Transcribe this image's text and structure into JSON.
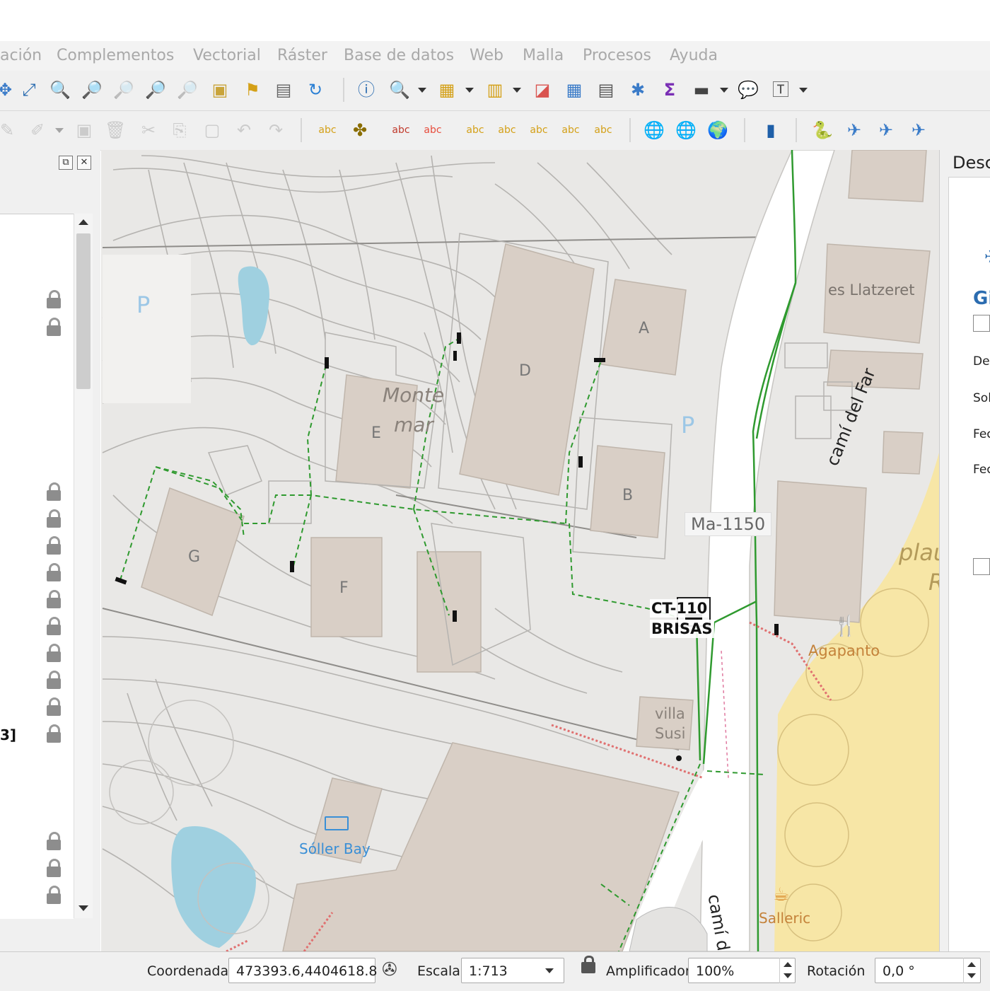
{
  "menubar": {
    "items": [
      "ación",
      "Complementos",
      "Vectorial",
      "Ráster",
      "Base de datos",
      "Web",
      "Malla",
      "Procesos",
      "Ayuda"
    ]
  },
  "toolbar1": {
    "icons": [
      "pan-map-icon",
      "zoom-full-icon",
      "zoom-in-icon",
      "zoom-out-icon",
      "zoom-native-icon",
      "zoom-selection-icon",
      "zoom-layer-icon",
      "zoom-last-icon",
      "new-bookmark-icon",
      "show-bookmarks-icon",
      "refresh-icon",
      "identify-icon",
      "select-feature-icon",
      "select-by-value-icon",
      "deselect-icon",
      "open-attribute-table-icon",
      "field-calculator-icon",
      "statistics-icon",
      "sum-icon",
      "measure-icon",
      "map-tips-icon",
      "text-annotation-icon"
    ]
  },
  "toolbar2": {
    "icons": [
      "digitize-icon",
      "edit-vertex-icon",
      "save-edits-icon",
      "delete-icon",
      "cut-icon",
      "copy-icon",
      "paste-icon",
      "undo-icon",
      "redo-icon",
      "label-icon",
      "label-style-icon",
      "label-pin-icon",
      "label-show-icon",
      "label-move-icon",
      "label-rotate-icon",
      "label-change-icon",
      "label-toggle-icon",
      "web-map-icon",
      "wms-icon",
      "globe-icon",
      "book-icon",
      "python-icon",
      "plugin-a-icon",
      "plugin-b-icon",
      "plugin-c-icon"
    ]
  },
  "left_panel": {
    "partial_text": "3]"
  },
  "right_panel": {
    "title": "Desc",
    "labels": [
      "Gi",
      "Des",
      "Sol",
      "Fec",
      "Fec"
    ]
  },
  "map_labels": {
    "road_top": "camí del Far",
    "road_bottom": "camí del Far",
    "road_code": "Ma-1150",
    "place_1": "Monte",
    "place_2": "mar",
    "area_label": "es Llatzeret",
    "ct_code": "CT-110",
    "ct_name": "BRISAS",
    "villa_1": "villa",
    "villa_2": "Susi",
    "hotel": "Sóller Bay",
    "restaurant": "Agapanto",
    "cafe": "Salleric",
    "beach_1": "plau",
    "beach_2": "R",
    "parking_1": "P",
    "parking_2": "P",
    "buildings": [
      "A",
      "B",
      "D",
      "E",
      "F",
      "G"
    ]
  },
  "statusbar": {
    "coord_label": "Coordenada",
    "coord_value": "473393.6,4404618.8",
    "scale_label": "Escala",
    "scale_value": "1:713",
    "magnifier_label": "Amplificador",
    "magnifier_value": "100%",
    "rotation_label": "Rotación",
    "rotation_value": "0,0 °"
  },
  "colors": {
    "map_bg": "#e9e8e6",
    "building": "#d9cfc6",
    "water": "#9fd0e0",
    "road": "#ffffff",
    "network_green": "#2f9a2f",
    "beach": "#f7e6a6",
    "alert_red": "#e07070"
  }
}
